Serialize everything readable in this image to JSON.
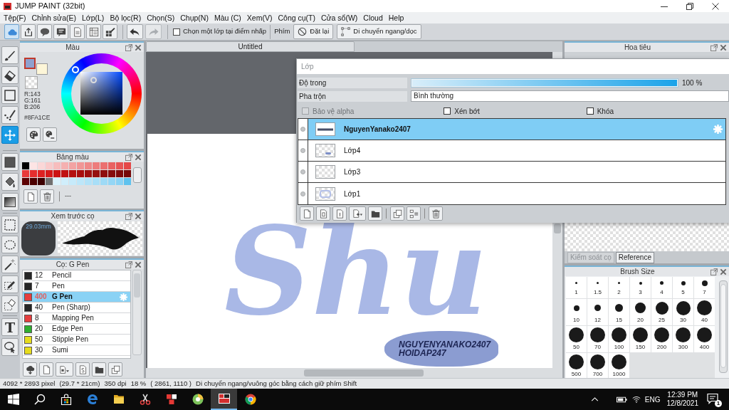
{
  "window": {
    "title": "JUMP PAINT (32bit)"
  },
  "menu": [
    "Tệp(F)",
    "Chỉnh sửa(E)",
    "Lớp(L)",
    "Bộ lọc(R)",
    "Chọn(S)",
    "Chụp(N)",
    "Màu (C)",
    "Xem(V)",
    "Công cụ(T)",
    "Cửa sổ(W)",
    "Cloud",
    "Help"
  ],
  "toolbar": {
    "actions": [
      {
        "selected": true
      },
      {
        "selected": false
      },
      {
        "selected": false
      },
      {
        "selected": false
      },
      {
        "selected": false
      },
      {
        "selected": false
      },
      {
        "selected": false
      }
    ],
    "history": [
      {
        "disabled": false
      },
      {
        "disabled": true
      }
    ],
    "pick_layer": {
      "label": "Chọn một lớp tại điểm nhấp",
      "checked": false
    },
    "key_label": "Phím",
    "buttons": [
      {
        "label": "Đặt lại"
      },
      {
        "label": "Di chuyển ngang/dọc"
      }
    ]
  },
  "tool_groups": [
    [
      {
        "selected": false
      },
      {
        "selected": false
      },
      {
        "selected": false
      },
      {
        "selected": false
      },
      {
        "selected": true
      }
    ],
    [
      {
        "selected": false
      },
      {
        "selected": false
      },
      {
        "selected": false
      }
    ],
    [
      {
        "selected": false
      },
      {
        "selected": false
      },
      {
        "selected": false
      },
      {
        "selected": false
      },
      {
        "selected": false
      }
    ],
    [
      {
        "selected": false,
        "label": "T"
      },
      {
        "selected": false
      }
    ]
  ],
  "color_panel": {
    "title": "Màu",
    "swatches": [
      {
        "kind": "foreground",
        "color": "#8fa1ce"
      },
      {
        "kind": "background",
        "color": "#fdf6d8"
      },
      {
        "kind": "transparent"
      }
    ],
    "rgb": [
      "R:143",
      "G:161",
      "B:206"
    ],
    "hex": "#8FA1CE"
  },
  "palette_panel": {
    "title": "Bảng màu",
    "colors": [
      {
        "color": "#000000"
      },
      {
        "color": "#fde4e4"
      },
      {
        "color": "#fbd7d7"
      },
      {
        "color": "#f9caca"
      },
      {
        "color": "#f7bdbd"
      },
      {
        "color": "#f5b0b0"
      },
      {
        "color": "#f3a3a3"
      },
      {
        "color": "#f19696"
      },
      {
        "color": "#ef8989"
      },
      {
        "color": "#ed7c7c"
      },
      {
        "color": "#eb6f6f"
      },
      {
        "color": "#e96262"
      },
      {
        "color": "#e75555"
      },
      {
        "color": "#e54848"
      },
      {
        "color": "#e83a3a"
      },
      {
        "color": "#e42e2e"
      },
      {
        "color": "#de2222"
      },
      {
        "color": "#d61a1a"
      },
      {
        "color": "#cc1414"
      },
      {
        "color": "#c01212"
      },
      {
        "color": "#b41010"
      },
      {
        "color": "#a80e0e"
      },
      {
        "color": "#9e1010"
      },
      {
        "color": "#961010"
      },
      {
        "color": "#8e0e0e"
      },
      {
        "color": "#860c0c"
      },
      {
        "color": "#7e0a0a"
      },
      {
        "color": "#760808"
      },
      {
        "color": "#5c0202"
      },
      {
        "color": "#4c0000"
      },
      {
        "color": "#3c0000"
      },
      {
        "color": "#707070"
      },
      {
        "color": "#daf2fc"
      },
      {
        "color": "#d0eefb"
      },
      {
        "color": "#c6eafa"
      },
      {
        "color": "#bce6f9"
      },
      {
        "color": "#b2e2f8"
      },
      {
        "color": "#a8def7"
      },
      {
        "color": "#9edaf6"
      },
      {
        "color": "#94d6f5"
      },
      {
        "color": "#8ad2f4"
      },
      {
        "color": "#5fc2ee"
      }
    ],
    "footer": "---"
  },
  "brush_preview": {
    "title": "Xem trước cọ",
    "size": "29.03mm"
  },
  "brush_list": {
    "title": "Cọ: G Pen",
    "items": [
      {
        "color": "#262626",
        "size": "12",
        "name": "Pencil",
        "selected": false
      },
      {
        "color": "#262626",
        "size": "7",
        "name": "Pen",
        "selected": false
      },
      {
        "color": "#e53e3e",
        "size": "400",
        "name": "G Pen",
        "selected": true
      },
      {
        "color": "#262626",
        "size": "40",
        "name": "Pen (Sharp)",
        "selected": false
      },
      {
        "color": "#e53e3e",
        "size": "8",
        "name": "Mapping Pen",
        "selected": false
      },
      {
        "color": "#2fae2f",
        "size": "20",
        "name": "Edge Pen",
        "selected": false
      },
      {
        "color": "#e6dc1e",
        "size": "50",
        "name": "Stipple Pen",
        "selected": false
      },
      {
        "color": "#e6dc1e",
        "size": "30",
        "name": "Sumi",
        "selected": false
      }
    ]
  },
  "document": {
    "tab": "Untitled",
    "artwork": "Shu",
    "stamp": [
      "NGUYENYANAKO2407",
      "HOIDAP247"
    ]
  },
  "layer_window": {
    "title": "Lớp",
    "opacity": {
      "label": "Độ trong",
      "level": 1,
      "reading": "100 %"
    },
    "blend": {
      "label": "Pha trộn",
      "value": "Bình thường"
    },
    "options": [
      {
        "label": "Bảo vệ alpha",
        "checked": false,
        "disabled": true
      },
      {
        "label": "Xén bớt",
        "checked": false,
        "disabled": false
      },
      {
        "label": "Khóa",
        "checked": false,
        "disabled": false
      }
    ],
    "layers": [
      {
        "name": "NguyenYanako2407",
        "selected": true
      },
      {
        "name": "Lớp4",
        "selected": false
      },
      {
        "name": "Lớp3",
        "selected": false
      },
      {
        "name": "Lớp1",
        "selected": false
      }
    ]
  },
  "navigator": {
    "title": "Hoa tiêu",
    "tabs": [
      {
        "label": "Kiểm soát cọ",
        "selected": false
      },
      {
        "label": "Reference",
        "selected": true
      }
    ]
  },
  "brush_size": {
    "title": "Brush Size",
    "sizes": [
      "1",
      "1.5",
      "2",
      "3",
      "4",
      "5",
      "7",
      "10",
      "12",
      "15",
      "20",
      "25",
      "30",
      "40",
      "50",
      "70",
      "100",
      "150",
      "200",
      "300",
      "400",
      "500",
      "700",
      "1000"
    ]
  },
  "status_bar": [
    "4092 * 2893 pixel",
    "(29.7 * 21cm)",
    "350 dpi",
    "18 %",
    "( 2861, 1110 )",
    "Di chuyển ngang/vuông góc bằng cách giữ phím Shift"
  ],
  "taskbar": {
    "apps": [
      {
        "selected": false
      },
      {
        "selected": false
      },
      {
        "selected": false
      },
      {
        "selected": false
      },
      {
        "selected": false
      },
      {
        "selected": false
      },
      {
        "selected": false
      },
      {
        "selected": false
      },
      {
        "selected": true
      },
      {
        "selected": false
      }
    ],
    "tray": {
      "language": "ENG",
      "time": "12:39 PM",
      "date": "12/8/2021",
      "notifications": "1"
    }
  }
}
